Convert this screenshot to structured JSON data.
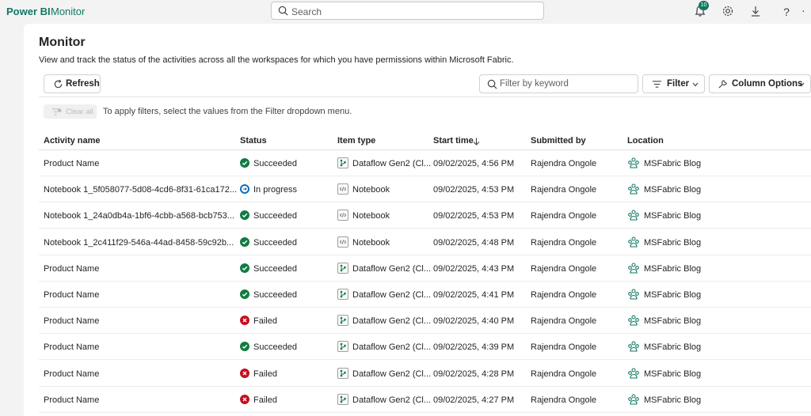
{
  "topbar": {
    "brand": "Power BI",
    "section": "Monitor",
    "search_placeholder": "Search",
    "notification_count": "10",
    "help": "?"
  },
  "page": {
    "title": "Monitor",
    "description": "View and track the status of the activities across all the workspaces for which you have permissions within Microsoft Fabric."
  },
  "toolbar": {
    "refresh_label": "Refresh",
    "filter_placeholder": "Filter by keyword",
    "filter_label": "Filter",
    "column_options_label": "Column Options",
    "clear_all_label": "Clear all",
    "hint": "To apply filters, select the values from the Filter dropdown menu."
  },
  "table": {
    "headers": {
      "activity": "Activity name",
      "status": "Status",
      "item_type": "Item type",
      "start_time": "Start time",
      "submitted_by": "Submitted by",
      "location": "Location"
    },
    "rows": [
      {
        "activity": "Product Name",
        "status": "Succeeded",
        "status_kind": "ok",
        "item_type": "Dataflow Gen2 (Cl...",
        "type_kind": "dataflow",
        "start_time": "09/02/2025, 4:56 PM",
        "submitted_by": "Rajendra Ongole",
        "location": "MSFabric Blog"
      },
      {
        "activity": "Notebook 1_5f058077-5d08-4cd6-8f31-61ca172...",
        "status": "In progress",
        "status_kind": "progress",
        "item_type": "Notebook",
        "type_kind": "notebook",
        "start_time": "09/02/2025, 4:53 PM",
        "submitted_by": "Rajendra Ongole",
        "location": "MSFabric Blog"
      },
      {
        "activity": "Notebook 1_24a0db4a-1bf6-4cbb-a568-bcb753...",
        "status": "Succeeded",
        "status_kind": "ok",
        "item_type": "Notebook",
        "type_kind": "notebook",
        "start_time": "09/02/2025, 4:53 PM",
        "submitted_by": "Rajendra Ongole",
        "location": "MSFabric Blog"
      },
      {
        "activity": "Notebook 1_2c411f29-546a-44ad-8458-59c92b...",
        "status": "Succeeded",
        "status_kind": "ok",
        "item_type": "Notebook",
        "type_kind": "notebook",
        "start_time": "09/02/2025, 4:48 PM",
        "submitted_by": "Rajendra Ongole",
        "location": "MSFabric Blog"
      },
      {
        "activity": "Product Name",
        "status": "Succeeded",
        "status_kind": "ok",
        "item_type": "Dataflow Gen2 (Cl...",
        "type_kind": "dataflow",
        "start_time": "09/02/2025, 4:43 PM",
        "submitted_by": "Rajendra Ongole",
        "location": "MSFabric Blog"
      },
      {
        "activity": "Product Name",
        "status": "Succeeded",
        "status_kind": "ok",
        "item_type": "Dataflow Gen2 (Cl...",
        "type_kind": "dataflow",
        "start_time": "09/02/2025, 4:41 PM",
        "submitted_by": "Rajendra Ongole",
        "location": "MSFabric Blog"
      },
      {
        "activity": "Product Name",
        "status": "Failed",
        "status_kind": "fail",
        "item_type": "Dataflow Gen2 (Cl...",
        "type_kind": "dataflow",
        "start_time": "09/02/2025, 4:40 PM",
        "submitted_by": "Rajendra Ongole",
        "location": "MSFabric Blog"
      },
      {
        "activity": "Product Name",
        "status": "Succeeded",
        "status_kind": "ok",
        "item_type": "Dataflow Gen2 (Cl...",
        "type_kind": "dataflow",
        "start_time": "09/02/2025, 4:39 PM",
        "submitted_by": "Rajendra Ongole",
        "location": "MSFabric Blog"
      },
      {
        "activity": "Product Name",
        "status": "Failed",
        "status_kind": "fail",
        "item_type": "Dataflow Gen2 (Cl...",
        "type_kind": "dataflow",
        "start_time": "09/02/2025, 4:28 PM",
        "submitted_by": "Rajendra Ongole",
        "location": "MSFabric Blog"
      },
      {
        "activity": "Product Name",
        "status": "Failed",
        "status_kind": "fail",
        "item_type": "Dataflow Gen2 (Cl...",
        "type_kind": "dataflow",
        "start_time": "09/02/2025, 4:27 PM",
        "submitted_by": "Rajendra Ongole",
        "location": "MSFabric Blog"
      }
    ]
  },
  "colors": {
    "brand": "#117865",
    "success": "#107c41",
    "failed": "#c50f1f",
    "in_progress": "#0f6cbd"
  },
  "icons": {
    "notifications": "bell-icon",
    "settings": "gear-icon",
    "download": "download-icon",
    "help": "help-icon",
    "search": "search-icon",
    "refresh": "refresh-icon",
    "filter": "filter-lines-icon",
    "column_options": "wrench-icon",
    "sort": "arrow-down-icon",
    "location": "workspace-people-icon"
  }
}
